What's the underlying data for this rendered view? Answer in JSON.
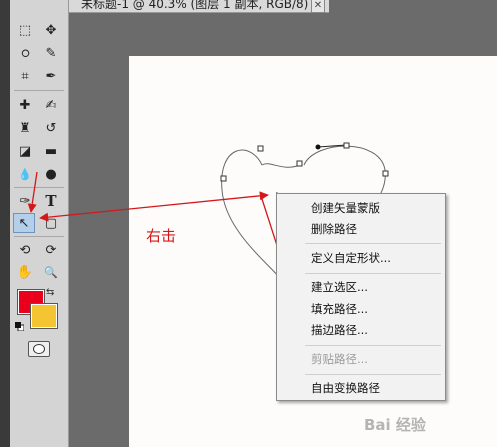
{
  "window": {
    "title": "未标题-1 @ 40.3% (图层 1 副本, RGB/8) *",
    "close_glyph": "✕"
  },
  "toolbox": {
    "tools": [
      {
        "name": "rectangular-marquee-icon",
        "glyph": "⬚"
      },
      {
        "name": "move-tool-icon",
        "glyph": "✥"
      },
      {
        "name": "lasso-icon",
        "glyph": "ഠ"
      },
      {
        "name": "quick-selection-icon",
        "glyph": "✎"
      },
      {
        "name": "crop-icon",
        "glyph": "⌗"
      },
      {
        "name": "eyedropper-icon",
        "glyph": "✒"
      },
      {
        "name": "healing-brush-icon",
        "glyph": "✚"
      },
      {
        "name": "brush-icon",
        "glyph": "✍"
      },
      {
        "name": "clone-stamp-icon",
        "glyph": "♜"
      },
      {
        "name": "history-brush-icon",
        "glyph": "↺"
      },
      {
        "name": "eraser-icon",
        "glyph": "◪"
      },
      {
        "name": "gradient-icon",
        "glyph": "▬"
      },
      {
        "name": "blur-icon",
        "glyph": "💧"
      },
      {
        "name": "dodge-icon",
        "glyph": "●"
      },
      {
        "name": "pen-icon",
        "glyph": "✑"
      },
      {
        "name": "type-icon",
        "glyph": "T"
      },
      {
        "name": "path-selection-icon",
        "glyph": "↖"
      },
      {
        "name": "rectangle-shape-icon",
        "glyph": "▢"
      },
      {
        "name": "3d-rotate-icon",
        "glyph": "⟲"
      },
      {
        "name": "3d-orbit-icon",
        "glyph": "⟳"
      },
      {
        "name": "hand-icon",
        "glyph": "✋"
      },
      {
        "name": "zoom-icon",
        "glyph": "🔍"
      }
    ],
    "foreground_color": "#e8001c",
    "background_color": "#f4c433",
    "swap_glyph": "⇆"
  },
  "annotation": {
    "label": "右击",
    "color": "#d3181a"
  },
  "context_menu": {
    "items": [
      {
        "label": "创建矢量蒙版",
        "enabled": true
      },
      {
        "label": "删除路径",
        "enabled": true
      },
      {
        "label": "定义自定形状...",
        "enabled": true
      },
      {
        "label": "建立选区...",
        "enabled": true
      },
      {
        "label": "填充路径...",
        "enabled": true
      },
      {
        "label": "描边路径...",
        "enabled": true
      },
      {
        "label": "剪贴路径...",
        "enabled": false
      },
      {
        "label": "自由变换路径",
        "enabled": true
      }
    ]
  },
  "watermark": "Bai 经验"
}
